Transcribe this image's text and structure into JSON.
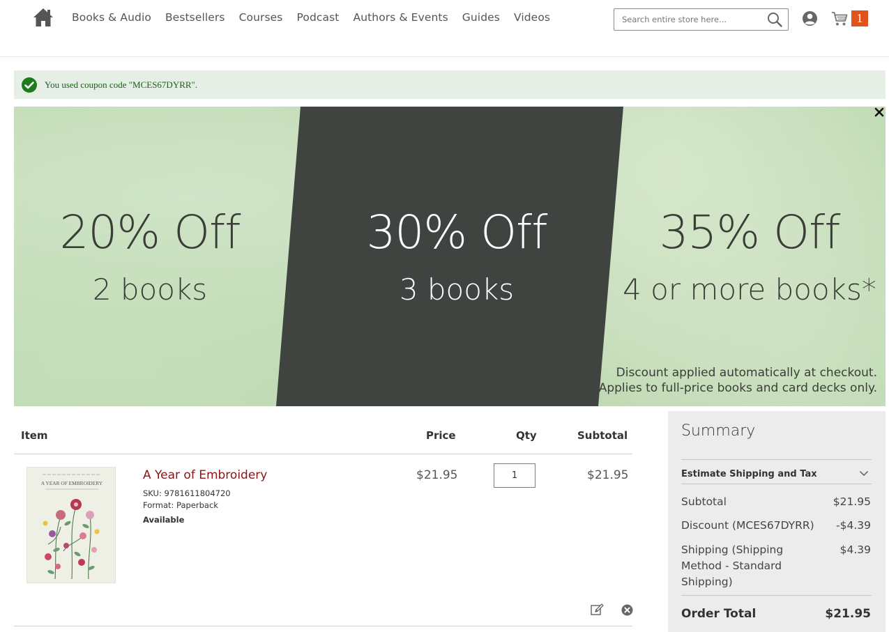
{
  "header": {
    "nav": [
      "Books & Audio",
      "Bestsellers",
      "Courses",
      "Podcast",
      "Authors & Events",
      "Guides",
      "Videos"
    ],
    "search_placeholder": "Search entire store here...",
    "cart_count": "1",
    "icons": [
      "home-icon",
      "search-icon",
      "account-icon",
      "cart-icon"
    ]
  },
  "message": {
    "text": "You used coupon code \"MCES67DYRR\"."
  },
  "banner": {
    "tiers": [
      {
        "percent": "20% Off",
        "quantity": "2 books"
      },
      {
        "percent": "30% Off",
        "quantity": "3 books"
      },
      {
        "percent": "35%  Off",
        "quantity": "4 or more books*"
      }
    ],
    "note_line1": "Discount applied automatically at checkout.",
    "note_line2": "Applies to full-price books and card decks only."
  },
  "cart": {
    "columns": {
      "item": "Item",
      "price": "Price",
      "qty": "Qty",
      "subtotal": "Subtotal"
    },
    "items": [
      {
        "name": "A Year of Embroidery",
        "sku": "SKU: 9781611804720",
        "format": "Format: Paperback",
        "availability": "Available",
        "price": "$21.95",
        "qty": "1",
        "subtotal": "$21.95",
        "cover_title": "A YEAR OF EMBROIDERY"
      }
    ]
  },
  "summary": {
    "title": "Summary",
    "estimate": "Estimate Shipping and Tax",
    "rows": [
      {
        "label": "Subtotal",
        "value": "$21.95"
      },
      {
        "label": "Discount (MCES67DYRR)",
        "value": "-$4.39"
      },
      {
        "label": "Shipping (Shipping Method - Standard Shipping)",
        "value": "$4.39"
      }
    ],
    "total_label": "Order Total",
    "total_value": "$21.95"
  },
  "colors": {
    "accent_orange": "#e0541c",
    "product_link": "#8b1414",
    "success_green": "#1a5e1a",
    "banner_dark": "#3f4441"
  }
}
